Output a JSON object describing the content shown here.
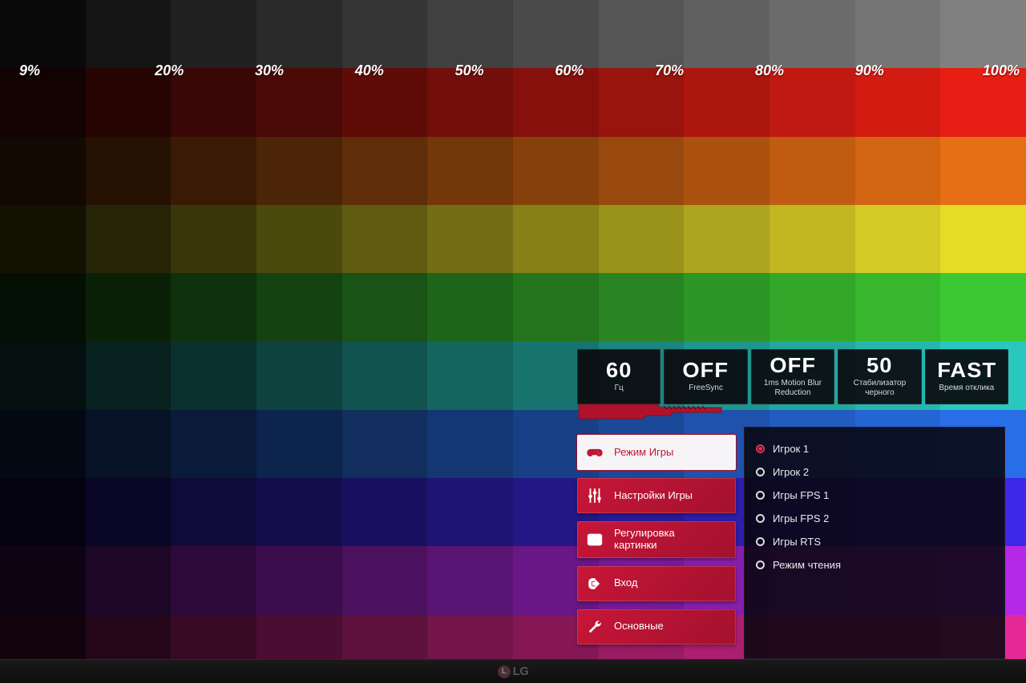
{
  "labels": [
    "9%",
    "20%",
    "30%",
    "40%",
    "50%",
    "60%",
    "70%",
    "80%",
    "90%",
    "100%"
  ],
  "status": [
    {
      "value": "60",
      "label": "Гц"
    },
    {
      "value": "OFF",
      "label": "FreeSync"
    },
    {
      "value": "OFF",
      "label": "1ms Motion Blur\nReduction"
    },
    {
      "value": "50",
      "label": "Стабилизатор\nчерного"
    },
    {
      "value": "FAST",
      "label": "Время отклика"
    }
  ],
  "menu": [
    {
      "label": "Режим Игры",
      "active": true,
      "icon": "gamepad"
    },
    {
      "label": "Настройки Игры",
      "active": false,
      "icon": "sliders"
    },
    {
      "label": "Регулировка\nкартинки",
      "active": false,
      "icon": "picture"
    },
    {
      "label": "Вход",
      "active": false,
      "icon": "input"
    },
    {
      "label": "Основные",
      "active": false,
      "icon": "tools"
    }
  ],
  "submenu": [
    {
      "label": "Игрок 1",
      "selected": true
    },
    {
      "label": "Игрок 2",
      "selected": false
    },
    {
      "label": "Игры FPS 1",
      "selected": false
    },
    {
      "label": "Игры FPS 2",
      "selected": false
    },
    {
      "label": "Игры RTS",
      "selected": false
    },
    {
      "label": "Режим чтения",
      "selected": false
    }
  ],
  "test_rows": [
    {
      "base": [
        128,
        128,
        128
      ]
    },
    {
      "base": [
        230,
        30,
        20
      ]
    },
    {
      "base": [
        230,
        110,
        20
      ]
    },
    {
      "base": [
        230,
        220,
        40
      ]
    },
    {
      "base": [
        60,
        200,
        50
      ]
    },
    {
      "base": [
        40,
        200,
        190
      ]
    },
    {
      "base": [
        40,
        110,
        230
      ]
    },
    {
      "base": [
        60,
        40,
        230
      ]
    },
    {
      "base": [
        180,
        40,
        230
      ]
    },
    {
      "base": [
        230,
        40,
        150
      ]
    }
  ],
  "brand": "LG"
}
